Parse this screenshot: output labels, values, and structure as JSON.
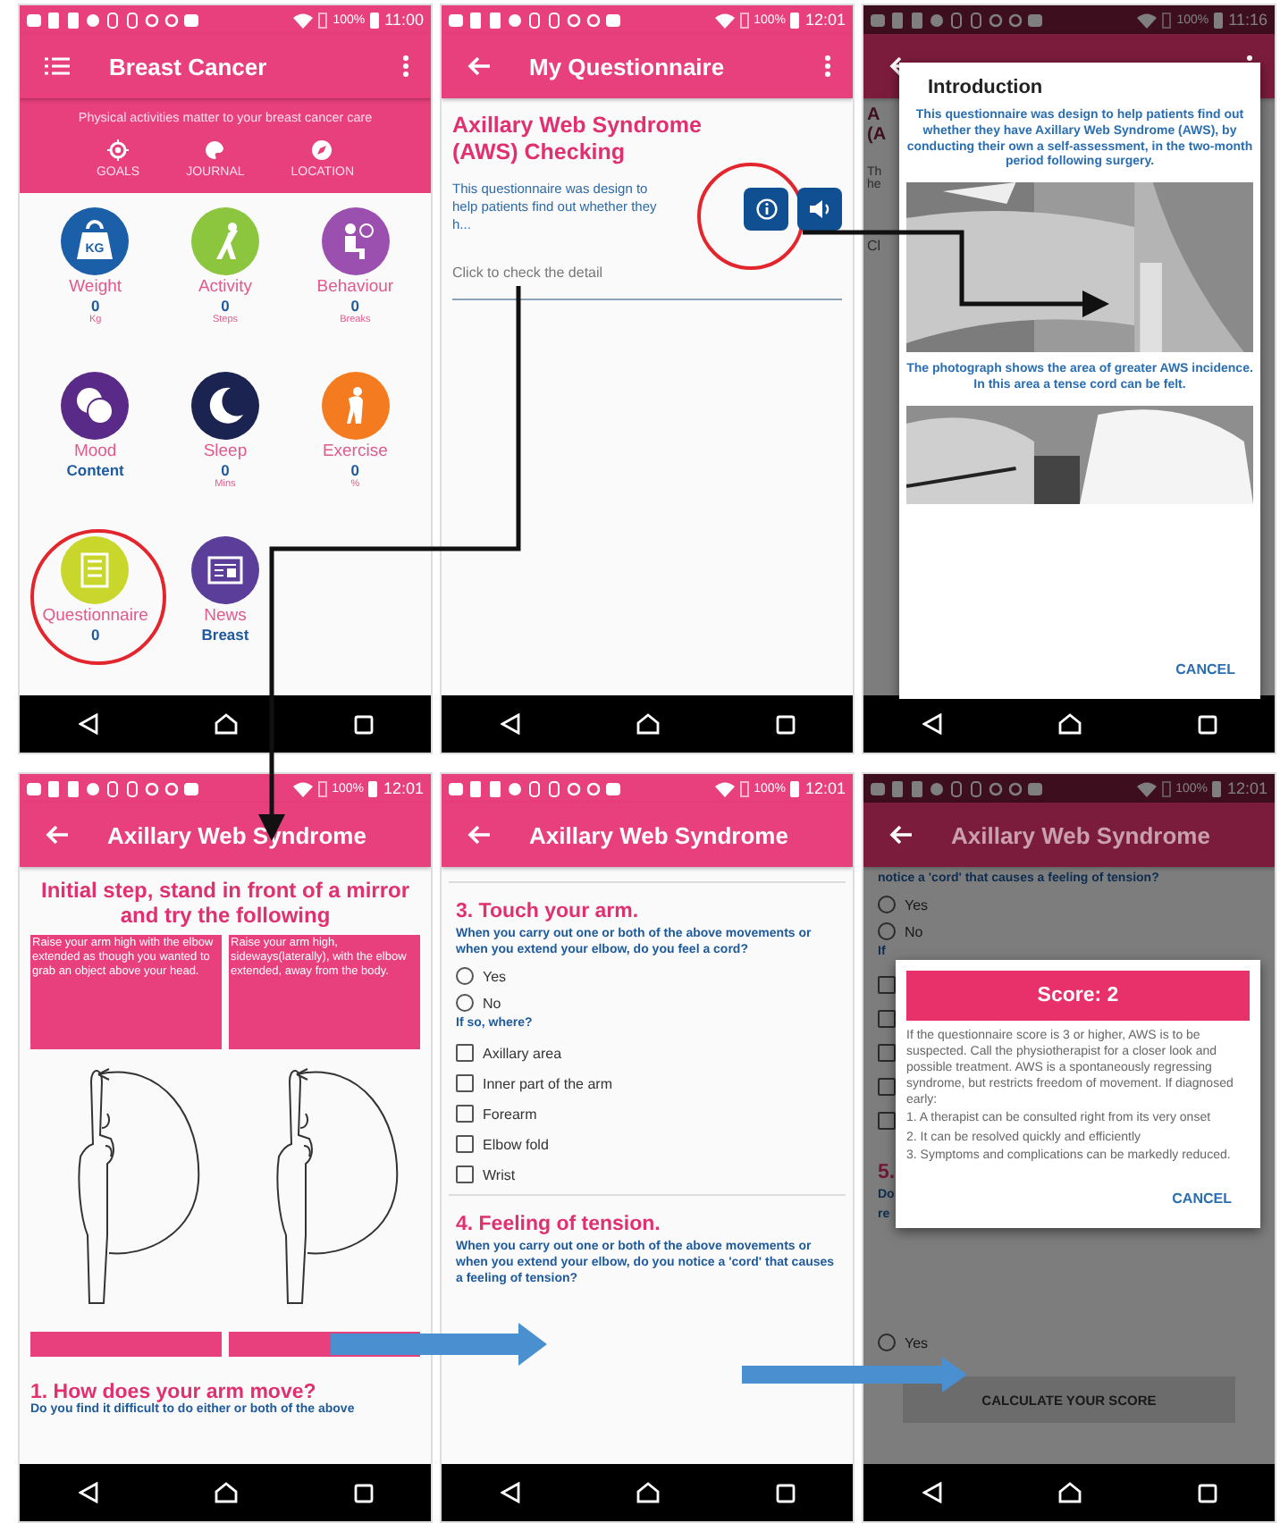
{
  "screens": [
    {
      "kind": "home",
      "time": "11:00",
      "battery": "100%",
      "dimmed": false,
      "title": "Breast Cancer",
      "overflow_menu": true,
      "tagline": "Physical activities matter to your breast cancer care",
      "shortcuts": [
        {
          "label": "GOALS"
        },
        {
          "label": "JOURNAL"
        },
        {
          "label": "LOCATION"
        }
      ],
      "tiles": [
        {
          "label": "Weight",
          "value": "0",
          "unit": "Kg",
          "color": "#1b5fa8",
          "icon_text": "KG",
          "highlighted": false
        },
        {
          "label": "Activity",
          "value": "0",
          "unit": "Steps",
          "color": "#8cc63f",
          "highlighted": false
        },
        {
          "label": "Behaviour",
          "value": "0",
          "unit": "Breaks",
          "color": "#9b4fae",
          "highlighted": false
        },
        {
          "label": "Mood",
          "value": "Content",
          "color": "#5a2a88",
          "highlighted": false
        },
        {
          "label": "Sleep",
          "value": "0",
          "unit": "Mins",
          "color": "#1b2350",
          "highlighted": false
        },
        {
          "label": "Exercise",
          "value": "0",
          "unit": "%",
          "color": "#f47b20",
          "highlighted": false
        },
        {
          "label": "Questionnaire",
          "value": "0",
          "color": "#c9d72c",
          "highlighted": true
        },
        {
          "label": "News",
          "value": "Breast",
          "color": "#5b3d9a",
          "highlighted": false
        }
      ]
    },
    {
      "kind": "questionnaire",
      "time": "12:01",
      "battery": "100%",
      "dimmed": false,
      "title": "My Questionnaire",
      "overflow_menu": true,
      "heading": "Axillary Web Syndrome (AWS) Checking",
      "summary": "This questionnaire was design to help patients find out whether they h...",
      "info_highlighted": true,
      "hint": "Click to check the detail"
    },
    {
      "kind": "intro_dialog",
      "time": "11:16",
      "battery": "100%",
      "dimmed": true,
      "overflow_menu": true,
      "behind": [
        "A",
        "(A",
        "Th",
        "he",
        "Cl"
      ],
      "dialog": {
        "title": "Introduction",
        "text": "This questionnaire was design to help patients find out whether they have Axillary Web Syndrome (AWS), by conducting their own a self-assessment, in the two-month period following surgery.",
        "caption": "The photograph shows the area of greater AWS incidence. In this area a tense cord can be felt.",
        "button": "CANCEL"
      }
    },
    {
      "kind": "instructions",
      "time": "12:01",
      "battery": "100%",
      "dimmed": false,
      "title": "Axillary Web Syndrome",
      "heading": "Initial step, stand in front of a mirror and try the following",
      "cards": [
        {
          "text": "Raise your arm high with the elbow extended as though you wanted to grab an object above your head."
        },
        {
          "text": "Raise your arm high, sideways(laterally), with the elbow extended, away from the body."
        }
      ],
      "question": "1. How does your arm move?",
      "prompt": "Do you find it difficult to do either or both of the above"
    },
    {
      "kind": "questions",
      "time": "12:01",
      "battery": "100%",
      "dimmed": false,
      "title": "Axillary Web Syndrome",
      "q3": {
        "heading": "3. Touch your arm.",
        "prompt": "When you carry out one or both of the above movements or when you extend your elbow, do you feel a cord?",
        "radios": [
          {
            "label": "Yes",
            "selected": false
          },
          {
            "label": "No",
            "selected": false
          }
        ],
        "subprompt": "If so, where?",
        "checks": [
          {
            "label": "Axillary area",
            "checked": false
          },
          {
            "label": "Inner part of the arm",
            "checked": false
          },
          {
            "label": "Forearm",
            "checked": false
          },
          {
            "label": "Elbow fold",
            "checked": false
          },
          {
            "label": "Wrist",
            "checked": false
          }
        ]
      },
      "q4": {
        "heading": "4. Feeling of tension.",
        "prompt": "When you carry out one or both of the above movements or when you extend your elbow, do you notice a 'cord' that causes a feeling of tension?"
      }
    },
    {
      "kind": "score_dialog",
      "time": "12:01",
      "battery": "100%",
      "dimmed": true,
      "title": "Axillary Web Syndrome",
      "behind": {
        "prompt_tail": "notice a 'cord' that causes a feeling of tension?",
        "radios": [
          {
            "label": "Yes",
            "selected": false
          },
          {
            "label": "No",
            "selected": false
          }
        ],
        "fragments": [
          "If",
          "5.",
          "Do",
          "re"
        ],
        "boxes": [
          {
            "checked": false
          },
          {
            "checked": false
          },
          {
            "checked": false
          },
          {
            "checked": false
          },
          {
            "checked": false
          }
        ],
        "radio_after": {
          "label": "Yes",
          "selected": false
        },
        "button": "CALCULATE YOUR SCORE"
      },
      "dialog": {
        "title": "Score: 2",
        "text": "If the questionnaire score is 3 or higher, AWS is to be suspected. Call the physiotherapist for a closer look and possible treatment. AWS is a spontaneously regressing syndrome, but restricts freedom of movement. If diagnosed early:",
        "items": [
          "1. A therapist can be consulted right from its very onset",
          "2. It can be resolved quickly and efficiently",
          "3. Symptoms and complications can be markedly reduced."
        ],
        "button": "CANCEL"
      }
    }
  ]
}
